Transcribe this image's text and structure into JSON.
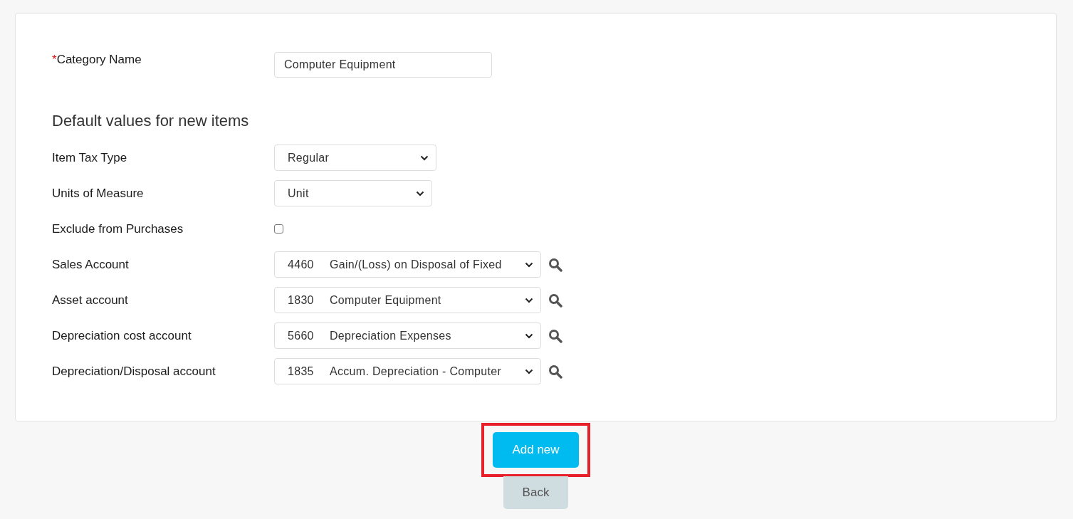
{
  "category_name": {
    "label": "Category Name",
    "required_mark": "*",
    "value": "Computer Equipment"
  },
  "section_title": "Default values for new items",
  "fields": [
    {
      "kind": "select",
      "label": "Item Tax Type",
      "value": "Regular"
    },
    {
      "kind": "select",
      "label": "Units of Measure",
      "value": "Unit"
    },
    {
      "kind": "checkbox",
      "label": "Exclude from Purchases",
      "checked": false
    },
    {
      "kind": "account",
      "label": "Sales Account",
      "code": "4460",
      "value": "Gain/(Loss) on Disposal of Fixed"
    },
    {
      "kind": "account",
      "label": "Asset account",
      "code": "1830",
      "value": "Computer Equipment"
    },
    {
      "kind": "account",
      "label": "Depreciation cost account",
      "code": "5660",
      "value": "Depreciation Expenses"
    },
    {
      "kind": "account",
      "label": "Depreciation/Disposal account",
      "code": "1835",
      "value": "Accum. Depreciation - Computer"
    }
  ],
  "buttons": [
    {
      "kind": "primary",
      "label": "Add new",
      "highlighted": true
    },
    {
      "kind": "secondary",
      "label": "Back",
      "highlighted": false
    }
  ]
}
